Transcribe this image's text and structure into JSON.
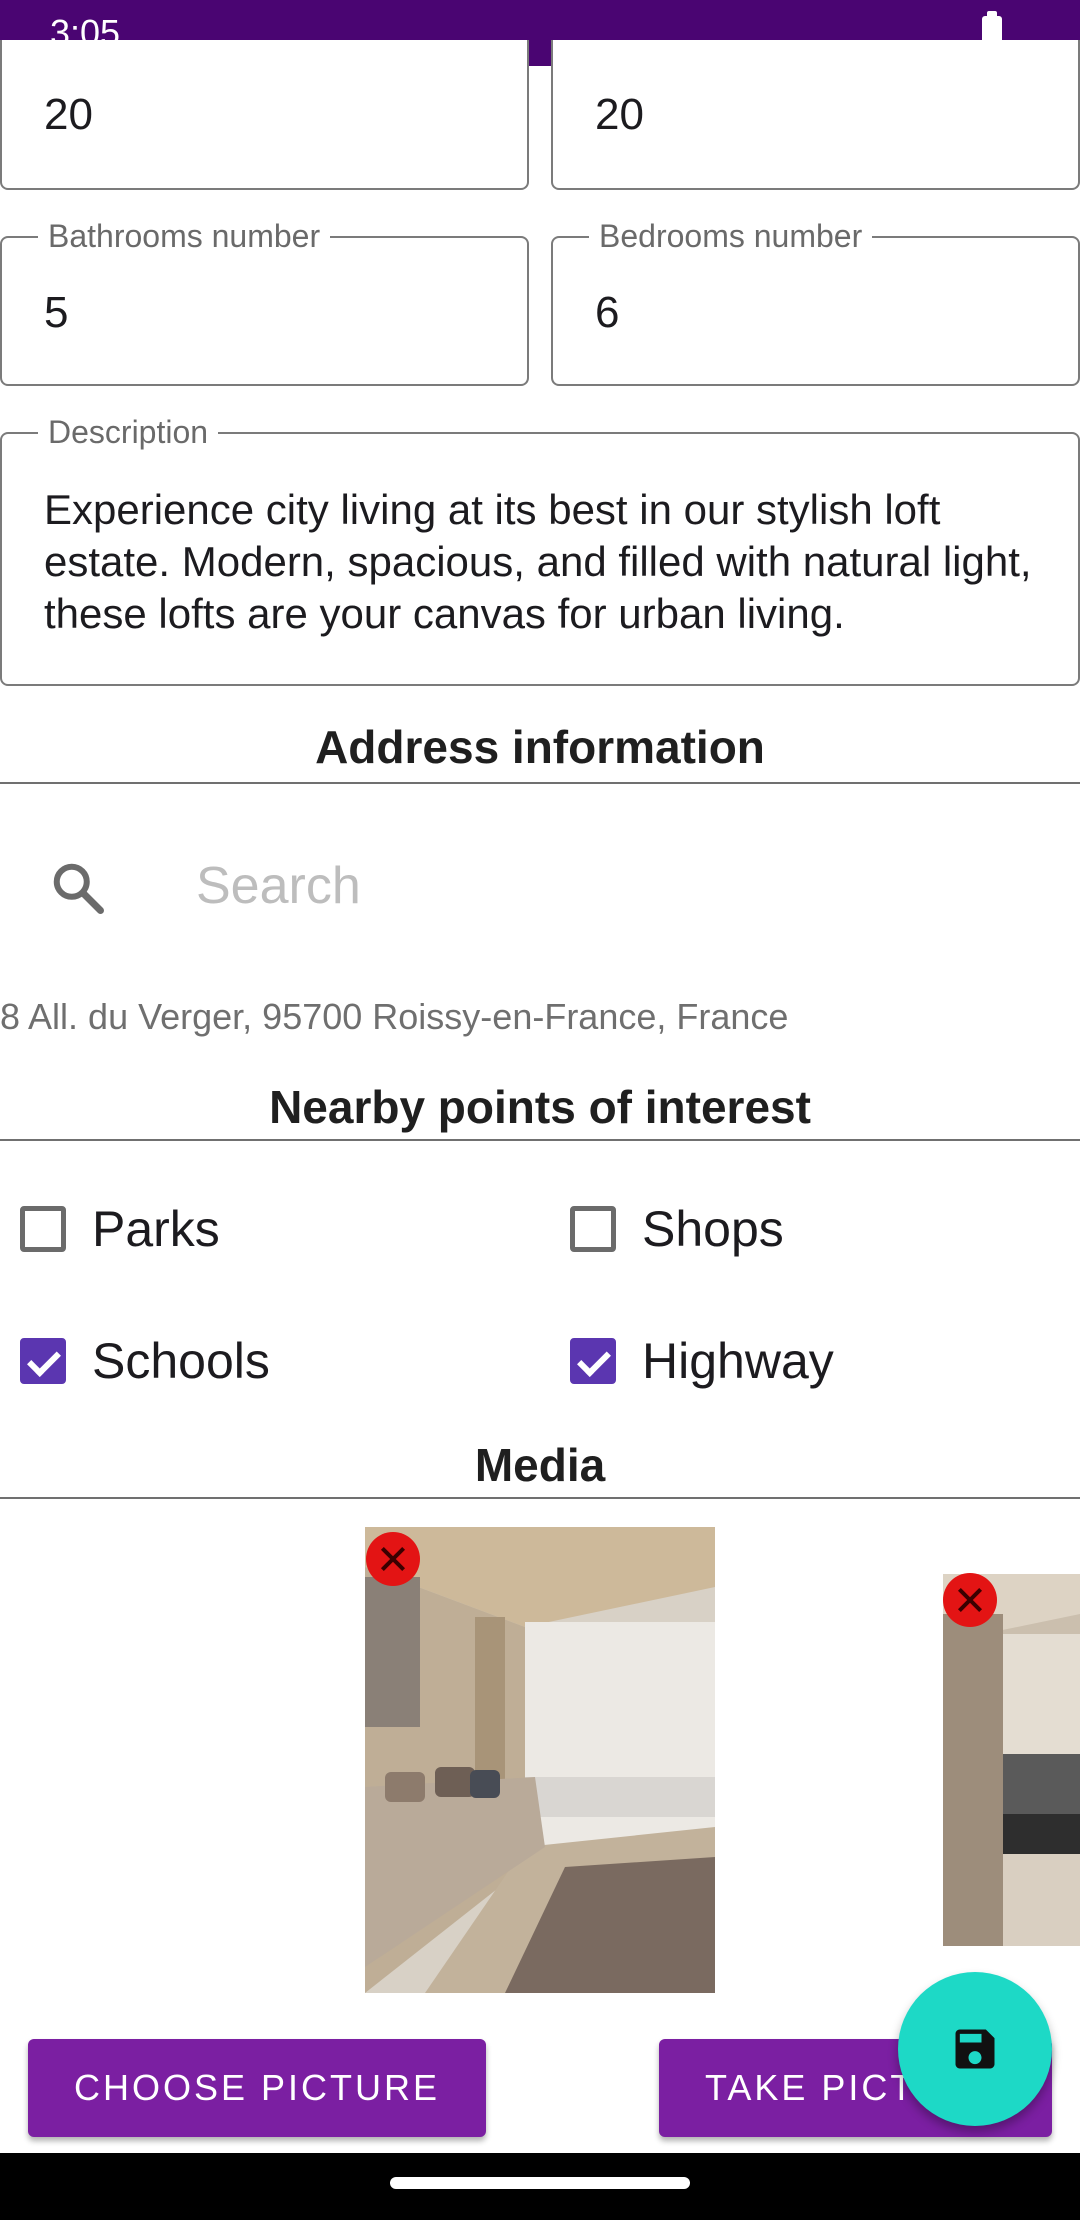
{
  "status_bar": {
    "time": "3:05"
  },
  "top_fields": {
    "left_value": "20",
    "right_value": "20"
  },
  "bathrooms": {
    "label": "Bathrooms number",
    "value": "5"
  },
  "bedrooms": {
    "label": "Bedrooms number",
    "value": "6"
  },
  "description": {
    "label": "Description",
    "value": "Experience city living at its best in our stylish loft estate. Modern, spacious, and filled with natural light, these lofts are your canvas for urban living."
  },
  "address_section": {
    "title": "Address information",
    "search_placeholder": "Search",
    "address": "8 All. du Verger, 95700 Roissy-en-France, France"
  },
  "poi_section": {
    "title": "Nearby points of interest",
    "items": [
      {
        "label": "Parks",
        "checked": false
      },
      {
        "label": "Shops",
        "checked": false
      },
      {
        "label": "Schools",
        "checked": true
      },
      {
        "label": "Highway",
        "checked": true
      }
    ]
  },
  "media_section": {
    "title": "Media",
    "choose_label": "CHOOSE PICTURE",
    "take_label": "TAKE PICTURE"
  },
  "colors": {
    "status_bar": "#4a0572",
    "accent_button": "#7b1fa2",
    "checkbox": "#5b36b0",
    "fab": "#1dd9c6",
    "delete": "#e31414"
  },
  "icons": {
    "battery": "battery-icon",
    "search": "search-icon",
    "delete": "close-icon",
    "save": "save-icon"
  }
}
